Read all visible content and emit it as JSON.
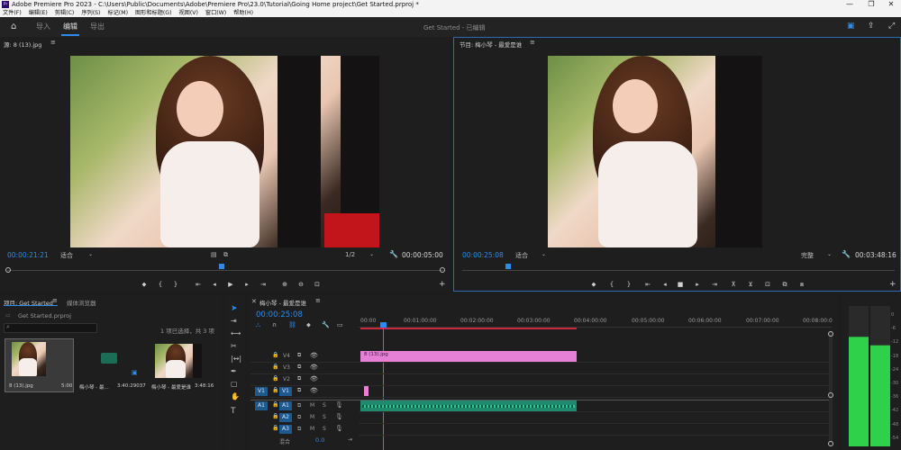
{
  "app": {
    "title": "Adobe Premiere Pro 2023 - C:\\Users\\Public\\Documents\\Adobe\\Premiere Pro\\23.0\\Tutorial\\Going Home project\\Get Started.prproj *",
    "logo": "Pr"
  },
  "menu": [
    "文件(F)",
    "编辑(E)",
    "剪辑(C)",
    "序列(S)",
    "标记(M)",
    "图形和标题(G)",
    "视图(V)",
    "窗口(W)",
    "帮助(H)"
  ],
  "header": {
    "tabs": [
      "导入",
      "编辑",
      "导出"
    ],
    "active_tab": "编辑",
    "project_status": "Get Started - 已编辑"
  },
  "source": {
    "title": "源: 8 (13).jpg",
    "timecode_in": "00:00:21:21",
    "fit": "适合",
    "resolution": "1/2",
    "timecode_out": "00:00:05:00"
  },
  "program": {
    "title": "节目: 梅小琴 - 最爱是谁",
    "timecode_in": "00:00:25:08",
    "fit": "适合",
    "quality": "完整",
    "timecode_out": "00:03:48:16"
  },
  "project": {
    "tab1": "项目: Get Started",
    "tab2": "媒体浏览器",
    "file": "Get Started.prproj",
    "selection": "1 项已选择，共 3 项",
    "items": [
      {
        "name": "8 (13).jpg",
        "duration": "5:00"
      },
      {
        "name": "梅小琴 - 最...",
        "duration": "3:40:29037"
      },
      {
        "name": "梅小琴 - 最爱是谁",
        "duration": "3:48:16"
      }
    ]
  },
  "timeline": {
    "title": "梅小琴 - 最爱是谁",
    "timecode": "00:00:25:08",
    "ruler": [
      "00:00",
      "00:01:00:00",
      "00:02:00:00",
      "00:03:00:00",
      "00:04:00:00",
      "00:05:00:00",
      "00:06:00:00",
      "00:07:00:00",
      "00:08:00:0"
    ],
    "video_tracks": [
      "V4",
      "V3",
      "V2",
      "V1"
    ],
    "audio_tracks": [
      "A1",
      "A2",
      "A3"
    ],
    "source_patch_v": "V1",
    "source_patch_a": "A1",
    "mix_label": "混合",
    "mix_value": "0.0",
    "clip_name": "8 (13).jpg"
  },
  "meter": {
    "labels": [
      "0",
      "-6",
      "-12",
      "-18",
      "-24",
      "-30",
      "-36",
      "-42",
      "-48",
      "-54"
    ],
    "level_left": 0.78,
    "level_right": 0.72
  },
  "colors": {
    "accent": "#2d8ceb",
    "clip_video": "#e67fd6",
    "clip_audio": "#1f8a6d",
    "meter": "#2fd14a"
  }
}
